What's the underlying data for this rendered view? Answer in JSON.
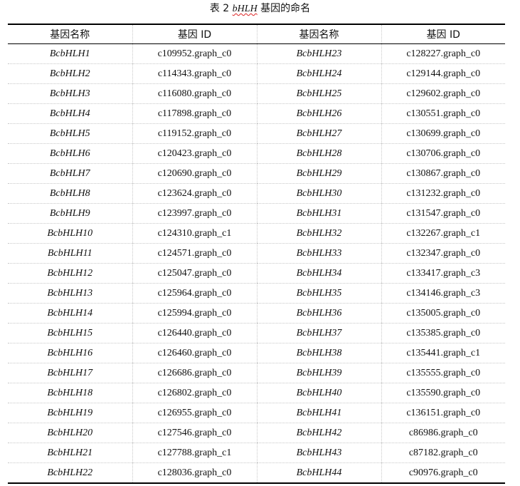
{
  "caption": {
    "prefix": "表 2 ",
    "italic": "bHLH",
    "suffix": " 基因的命名"
  },
  "headers": [
    "基因名称",
    "基因 ID",
    "基因名称",
    "基因 ID"
  ],
  "rows": [
    [
      "BcbHLH1",
      "c109952.graph_c0",
      "BcbHLH23",
      "c128227.graph_c0"
    ],
    [
      "BcbHLH2",
      "c114343.graph_c0",
      "BcbHLH24",
      "c129144.graph_c0"
    ],
    [
      "BcbHLH3",
      "c116080.graph_c0",
      "BcbHLH25",
      "c129602.graph_c0"
    ],
    [
      "BcbHLH4",
      "c117898.graph_c0",
      "BcbHLH26",
      "c130551.graph_c0"
    ],
    [
      "BcbHLH5",
      "c119152.graph_c0",
      "BcbHLH27",
      "c130699.graph_c0"
    ],
    [
      "BcbHLH6",
      "c120423.graph_c0",
      "BcbHLH28",
      "c130706.graph_c0"
    ],
    [
      "BcbHLH7",
      "c120690.graph_c0",
      "BcbHLH29",
      "c130867.graph_c0"
    ],
    [
      "BcbHLH8",
      "c123624.graph_c0",
      "BcbHLH30",
      "c131232.graph_c0"
    ],
    [
      "BcbHLH9",
      "c123997.graph_c0",
      "BcbHLH31",
      "c131547.graph_c0"
    ],
    [
      "BcbHLH10",
      "c124310.graph_c1",
      "BcbHLH32",
      "c132267.graph_c1"
    ],
    [
      "BcbHLH11",
      "c124571.graph_c0",
      "BcbHLH33",
      "c132347.graph_c0"
    ],
    [
      "BcbHLH12",
      "c125047.graph_c0",
      "BcbHLH34",
      "c133417.graph_c3"
    ],
    [
      "BcbHLH13",
      "c125964.graph_c0",
      "BcbHLH35",
      "c134146.graph_c3"
    ],
    [
      "BcbHLH14",
      "c125994.graph_c0",
      "BcbHLH36",
      "c135005.graph_c0"
    ],
    [
      "BcbHLH15",
      "c126440.graph_c0",
      "BcbHLH37",
      "c135385.graph_c0"
    ],
    [
      "BcbHLH16",
      "c126460.graph_c0",
      "BcbHLH38",
      "c135441.graph_c1"
    ],
    [
      "BcbHLH17",
      "c126686.graph_c0",
      "BcbHLH39",
      "c135555.graph_c0"
    ],
    [
      "BcbHLH18",
      "c126802.graph_c0",
      "BcbHLH40",
      "c135590.graph_c0"
    ],
    [
      "BcbHLH19",
      "c126955.graph_c0",
      "BcbHLH41",
      "c136151.graph_c0"
    ],
    [
      "BcbHLH20",
      "c127546.graph_c0",
      "BcbHLH42",
      "c86986.graph_c0"
    ],
    [
      "BcbHLH21",
      "c127788.graph_c1",
      "BcbHLH43",
      "c87182.graph_c0"
    ],
    [
      "BcbHLH22",
      "c128036.graph_c0",
      "BcbHLH44",
      "c90976.graph_c0"
    ]
  ]
}
